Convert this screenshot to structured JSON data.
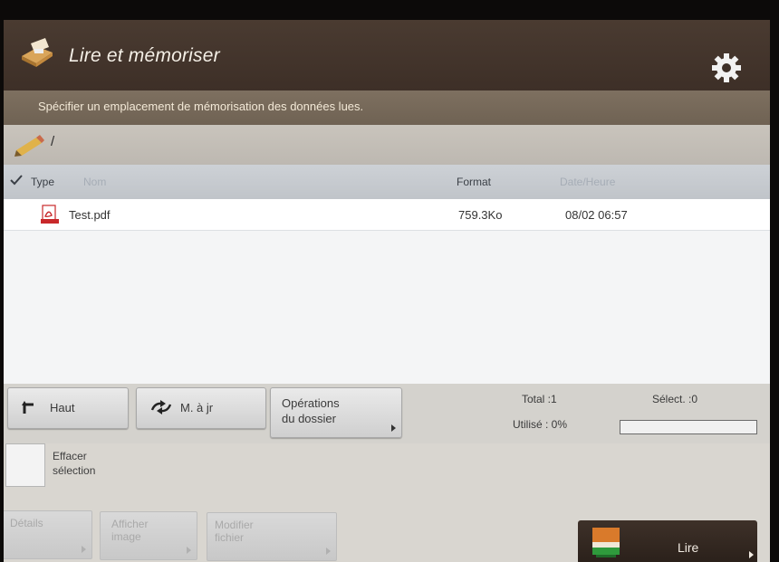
{
  "header": {
    "title": "Lire et mémoriser",
    "subtitle": "Spécifier un emplacement de mémorisation des données lues.",
    "settings_icon": "gear-icon",
    "app_icon": "scan-and-store-icon"
  },
  "path": {
    "text": "/",
    "icon": "pencil-icon"
  },
  "table": {
    "columns": {
      "type": "Type",
      "name": "Nom",
      "format": "Format",
      "date": "Date/Heure"
    },
    "rows": [
      {
        "icon": "pdf-file-icon",
        "name": "Test.pdf",
        "size": "759.3Ko",
        "date": "08/02 06:57"
      }
    ]
  },
  "toolbar": {
    "up_label": "Haut",
    "refresh_label": "M. à jr",
    "folder_ops_line1": "Opérations",
    "folder_ops_line2": "du dossier",
    "total": "Total :1",
    "selected": "Sélect. :0",
    "used": "Utilisé : 0%",
    "used_fraction": 0
  },
  "clear_selection": {
    "line1": "Effacer",
    "line2": "sélection"
  },
  "actions": {
    "details": "Détails",
    "show_image_line1": "Afficher",
    "show_image_line2": "image",
    "modify_file_line1": "Modifier",
    "modify_file_line2": "fichier",
    "read": "Lire"
  },
  "colors": {
    "titlebar": "#4a3b31",
    "subbar": "#7e7060",
    "start_button": "#3e3129",
    "pdf_red": "#c8282a"
  }
}
